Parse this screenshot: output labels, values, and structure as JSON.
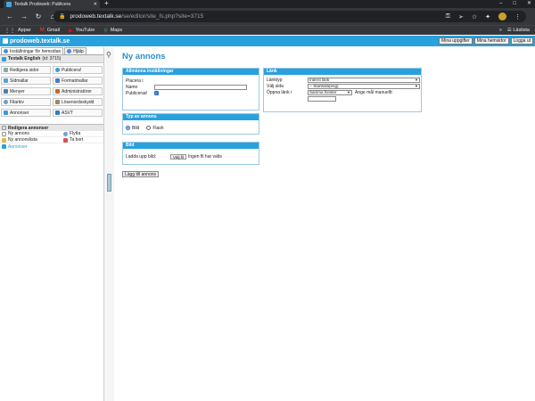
{
  "browser": {
    "tab_title": "Textalk Prodoweb: Publicera",
    "tab_close": "✕",
    "new_tab": "+",
    "window_controls": [
      "–",
      "□",
      "✕"
    ],
    "url_host": "prodoweb.textalk.se",
    "url_path": "/se/editor/site_fs.php?site=3715",
    "bookmarks": [
      {
        "label": "Appar",
        "icon": "apps-icon"
      },
      {
        "label": "Gmail",
        "icon": "gmail-icon"
      },
      {
        "label": "YouTube",
        "icon": "youtube-icon"
      },
      {
        "label": "Maps",
        "icon": "maps-icon"
      }
    ],
    "reading_list": "Läslista"
  },
  "app": {
    "brand": "prodoweb.textalk.se",
    "top_buttons": [
      "Mina uppgifter",
      "Mina hemsidor",
      "Logga ut"
    ]
  },
  "sidebar": {
    "tabs": [
      "Inställningar för hemsidan",
      "Hjälp"
    ],
    "site_name": "Textalk English",
    "site_id": "(id: 3715)",
    "grid": [
      "Redigera sidor",
      "Publicera!",
      "Sidmallar",
      "Formatmallar",
      "Menyer",
      "Administratörer",
      "Filarkiv",
      "Lösenordsskydd",
      "Annonser",
      "ASVT"
    ],
    "ads_header": "Redigera annonser",
    "ads_rows": [
      {
        "left": "Ny annons",
        "right": "Flytta"
      },
      {
        "left": "Ny annonslista",
        "right": "Ta bort"
      }
    ],
    "ads_selected": "Annonser"
  },
  "main": {
    "title": "Ny annons",
    "general": {
      "header": "Allmänna inställningar",
      "place_label": "Placera i",
      "name_label": "Namn",
      "name_value": "",
      "published_label": "Publicerad",
      "published_checked": true
    },
    "link": {
      "header": "Länk",
      "linktype_label": "Länktyp",
      "linktype_value": "Internt länk",
      "page_label": "Välj sida",
      "page_value": "-- Startsida(eng)",
      "open_label": "Öppna länk i",
      "open_value": "Samma fönster",
      "manual_label": "Ange mål manuellt:"
    },
    "adtype": {
      "header": "Typ av annons",
      "options": [
        "Bild",
        "Flash"
      ],
      "selected": "Bild"
    },
    "image": {
      "header": "Bild",
      "upload_label": "Ladda upp bild:",
      "choose_button": "Välj fil",
      "no_file": "Ingen fil har valts"
    },
    "save_button": "Lägg till annons"
  }
}
